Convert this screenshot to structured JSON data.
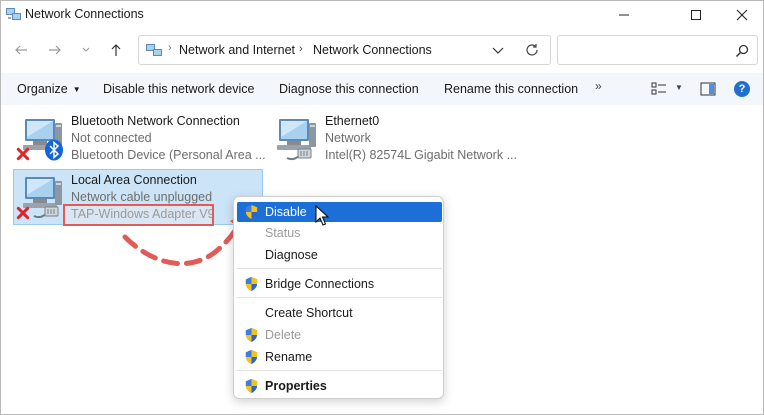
{
  "window": {
    "title": "Network Connections"
  },
  "address": {
    "crumbs": [
      "Network and Internet",
      "Network Connections"
    ],
    "search_value": ""
  },
  "commands": {
    "organize": "Organize",
    "disable": "Disable this network device",
    "diagnose": "Diagnose this connection",
    "rename": "Rename this connection",
    "more": "»"
  },
  "connections": [
    {
      "name": "Bluetooth Network Connection",
      "status": "Not connected",
      "device": "Bluetooth Device (Personal Area ...",
      "icon": "bluetooth-computer-icon",
      "error": true
    },
    {
      "name": "Ethernet0",
      "status": "Network",
      "device": "Intel(R) 82574L Gigabit Network ...",
      "icon": "ethernet-computer-icon",
      "error": false
    },
    {
      "name": "Local Area Connection",
      "status": "Network cable unplugged",
      "device": "TAP-Windows Adapter V9",
      "icon": "lan-computer-icon",
      "error": true,
      "selected": true
    }
  ],
  "context_menu": {
    "items": [
      {
        "label": "Disable",
        "shield": true,
        "state": "active"
      },
      {
        "label": "Status",
        "shield": false,
        "state": "disabled"
      },
      {
        "label": "Diagnose",
        "shield": false,
        "state": "normal"
      },
      {
        "label": "Bridge Connections",
        "shield": true,
        "state": "normal"
      },
      {
        "label": "Create Shortcut",
        "shield": false,
        "state": "normal"
      },
      {
        "label": "Delete",
        "shield": true,
        "state": "disabled"
      },
      {
        "label": "Rename",
        "shield": true,
        "state": "normal"
      },
      {
        "label": "Properties",
        "shield": true,
        "state": "bold"
      }
    ]
  },
  "colors": {
    "accent": "#1b6fd6",
    "selection": "#cce4f7",
    "annotation": "#e15b57",
    "error": "#e0242a"
  }
}
